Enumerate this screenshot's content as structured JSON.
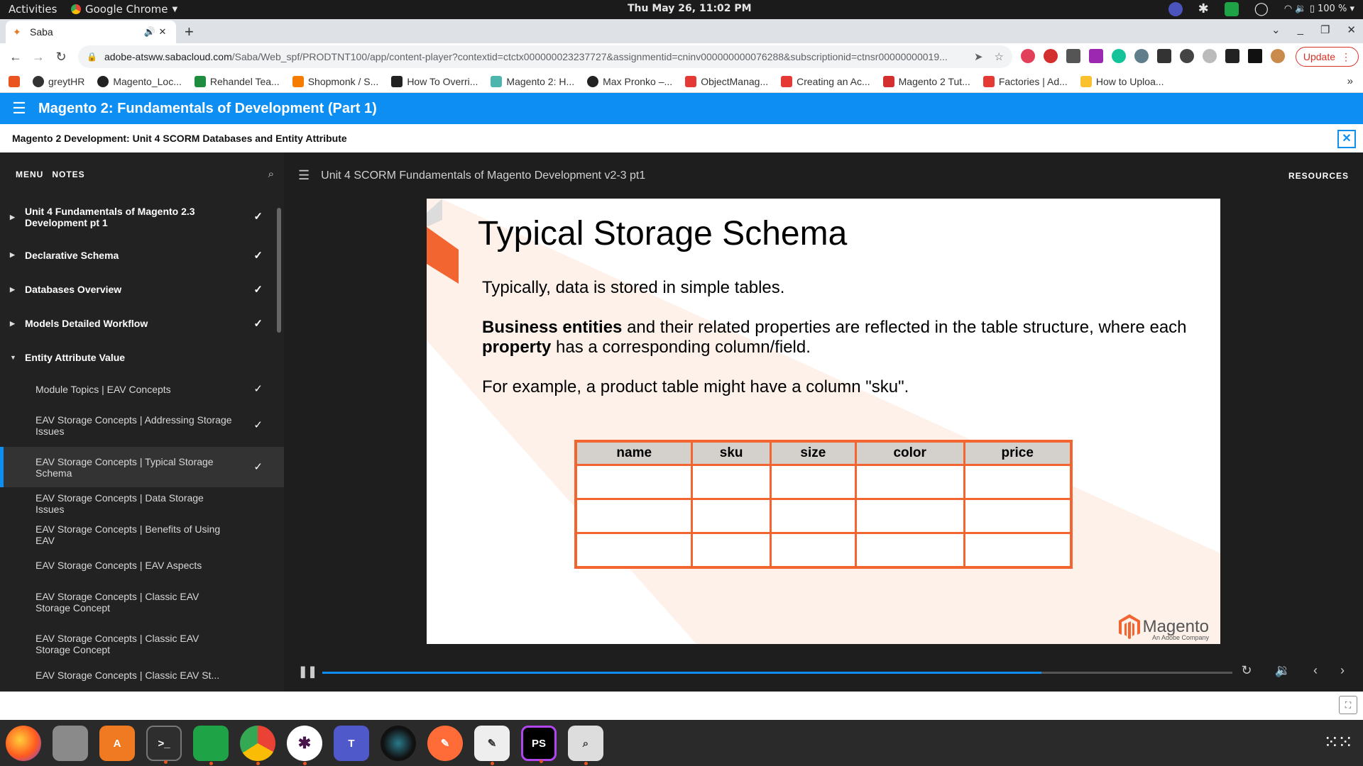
{
  "topbar": {
    "activities": "Activities",
    "app_name": "Google Chrome",
    "clock": "Thu May 26, 11:02 PM",
    "battery": "100 %"
  },
  "browser": {
    "tab_title": "Saba",
    "url_host": "adobe-atsww.sabacloud.com",
    "url_path": "/Saba/Web_spf/PRODTNT100/app/content-player?contextid=ctctx000000023237727&assignmentid=cninv000000000076288&subscriptionid=ctnsr00000000019...",
    "update_label": "Update",
    "bookmarks": [
      "greytHR",
      "Magento_Loc...",
      "Rehandel Tea...",
      "Shopmonk / S...",
      "How To Overri...",
      "Magento 2: H...",
      "Max Pronko –...",
      "ObjectManag...",
      "Creating an Ac...",
      "Magento 2 Tut...",
      "Factories | Ad...",
      "How to Uploa..."
    ]
  },
  "app": {
    "course_title": "Magento 2: Fundamentals of Development (Part 1)",
    "unit_title": "Magento 2 Development: Unit 4 SCORM Databases and Entity Attribute"
  },
  "sidebar": {
    "tab_menu": "MENU",
    "tab_notes": "NOTES",
    "sections": [
      {
        "label": "Unit 4 Fundamentals of Magento 2.3 Development pt 1",
        "done": true
      },
      {
        "label": "Declarative Schema",
        "done": true
      },
      {
        "label": "Databases Overview",
        "done": true
      },
      {
        "label": "Models Detailed Workflow",
        "done": true
      },
      {
        "label": "Entity Attribute Value",
        "done": false
      }
    ],
    "items": [
      {
        "label": "Module Topics | EAV Concepts",
        "done": true
      },
      {
        "label": "EAV Storage Concepts | Addressing Storage Issues",
        "done": true
      },
      {
        "label": "EAV Storage Concepts | Typical Storage Schema",
        "done": true
      },
      {
        "label": "EAV Storage Concepts | Data Storage Issues",
        "done": false
      },
      {
        "label": "EAV Storage Concepts | Benefits of Using EAV",
        "done": false
      },
      {
        "label": "EAV Storage Concepts | EAV Aspects",
        "done": false
      },
      {
        "label": "EAV Storage Concepts | Classic EAV Storage Concept",
        "done": false
      },
      {
        "label": "EAV Storage Concepts | Classic EAV Storage Concept",
        "done": false
      },
      {
        "label": "EAV Storage Concepts | Classic EAV St...",
        "done": false
      }
    ]
  },
  "content": {
    "module_title": "Unit 4 SCORM Fundamentals of Magento Development v2-3 pt1",
    "resources_label": "RESOURCES",
    "progress_fraction": 0.79
  },
  "slide": {
    "title": "Typical Storage Schema",
    "line1": "Typically, data is stored in simple tables.",
    "line2_bold1": "Business entities",
    "line2_mid": " and their related properties are reflected in the table structure, where each ",
    "line2_bold2": "property",
    "line2_end": " has a corresponding column/field.",
    "line3": "For example, a product table might have a column \"sku\".",
    "table_headers": [
      "name",
      "sku",
      "size",
      "color",
      "price"
    ],
    "logo_text": "Magento",
    "logo_sub": "An Adobe Company"
  },
  "colors": {
    "accent": "#0d8ef3",
    "magento_orange": "#f26530"
  }
}
